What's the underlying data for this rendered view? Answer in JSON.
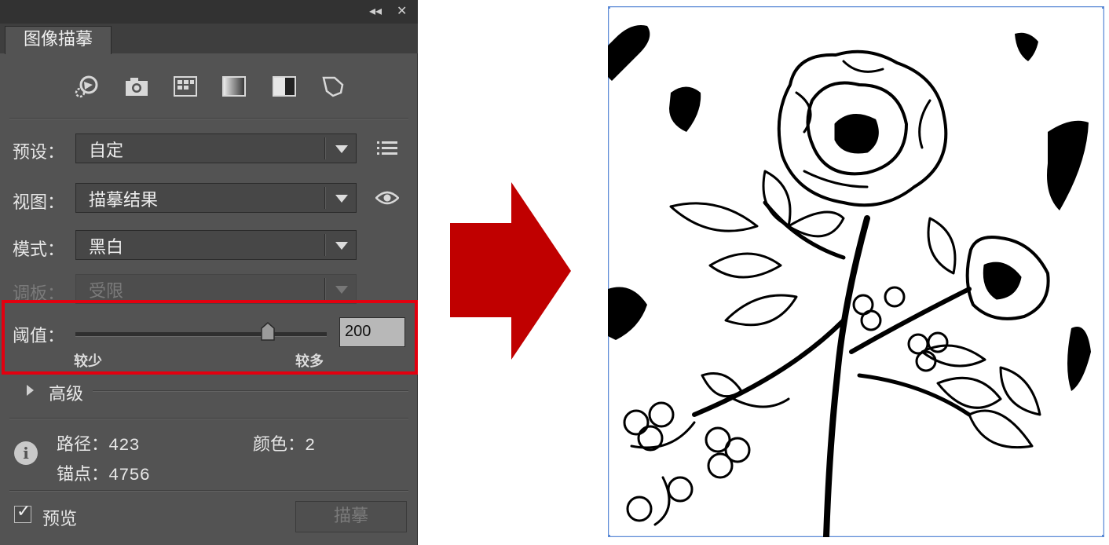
{
  "panel": {
    "title_tab": "图像描摹",
    "titlebar_buttons": {
      "collapse": "◂◂",
      "close": "✕"
    },
    "presets_icons": [
      "auto-color-icon",
      "high-color-icon",
      "low-color-icon",
      "grayscale-icon",
      "black-white-icon",
      "outline-icon"
    ],
    "preset": {
      "label": "预设：",
      "value": "自定"
    },
    "view": {
      "label": "视图：",
      "value": "描摹结果"
    },
    "mode": {
      "label": "模式：",
      "value": "黑白"
    },
    "palette": {
      "label": "调板：",
      "value": "受限"
    },
    "threshold": {
      "label": "阈值：",
      "value": "200",
      "slider_fraction": 0.78,
      "min_label": "较少",
      "max_label": "较多"
    },
    "advanced": {
      "label": "高级"
    },
    "stats": {
      "paths_label": "路径：",
      "paths_value": "423",
      "colors_label": "颜色：",
      "colors_value": "2",
      "anchors_label": "锚点：",
      "anchors_value": "4756"
    },
    "preview": {
      "label": "预览",
      "checked": true
    },
    "trace_button": "描摹"
  },
  "colors": {
    "panel_bg": "#535353",
    "highlight": "#e3000f",
    "arrow": "#c00000",
    "selection_frame": "#5b8ad6"
  }
}
